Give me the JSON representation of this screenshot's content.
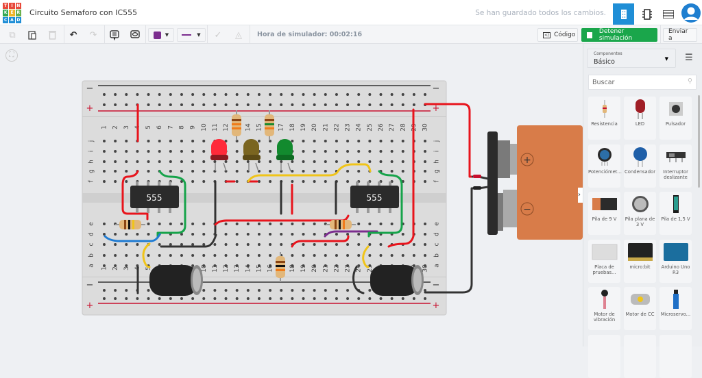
{
  "app": {
    "logo_letters": [
      "T",
      "I",
      "N",
      "K",
      "E",
      "R",
      "C",
      "A",
      "D"
    ],
    "title": "Circuito Semaforo con IC555",
    "save_status": "Se han guardado todos los cambios."
  },
  "header_icons": [
    "breadboard-view-icon",
    "schematic-view-icon",
    "component-list-icon",
    "user-avatar-icon"
  ],
  "toolbar": {
    "sim_time_label": "Hora de simulador: 00:02:16",
    "code_label": "Código",
    "stop_sim_label": "Detener simulación",
    "send_label": "Enviar a",
    "wire_color": "#7b2d8e"
  },
  "sidebar": {
    "components_label": "Componentes",
    "components_value": "Básico",
    "search_placeholder": "Buscar",
    "items": [
      {
        "label": "Resistencia",
        "icon": "resistor"
      },
      {
        "label": "LED",
        "icon": "led"
      },
      {
        "label": "Pulsador",
        "icon": "pushbutton"
      },
      {
        "label": "Potenciómet...",
        "icon": "potentiometer"
      },
      {
        "label": "Condensador",
        "icon": "capacitor"
      },
      {
        "label": "Interruptor deslizante",
        "icon": "slide-switch"
      },
      {
        "label": "Pila de 9 V",
        "icon": "battery-9v"
      },
      {
        "label": "Pila plana de 3 V",
        "icon": "coin-cell"
      },
      {
        "label": "Pila de 1,5 V",
        "icon": "battery-aa"
      },
      {
        "label": "Placa de pruebas...",
        "icon": "breadboard"
      },
      {
        "label": "micro:bit",
        "icon": "microbit"
      },
      {
        "label": "Arduino Uno R3",
        "icon": "arduino"
      },
      {
        "label": "Motor de vibración",
        "icon": "vibration-motor"
      },
      {
        "label": "Motor de CC",
        "icon": "dc-motor"
      },
      {
        "label": "Microservo...",
        "icon": "microservo"
      },
      {
        "label": "",
        "icon": "more"
      },
      {
        "label": "",
        "icon": "more"
      },
      {
        "label": "",
        "icon": "more"
      }
    ]
  },
  "breadboard": {
    "columns": [
      "1",
      "2",
      "3",
      "4",
      "5",
      "6",
      "7",
      "8",
      "9",
      "10",
      "11",
      "12",
      "13",
      "14",
      "15",
      "16",
      "17",
      "18",
      "19",
      "20",
      "21",
      "22",
      "23",
      "24",
      "25",
      "26",
      "27",
      "28",
      "29",
      "30"
    ],
    "rows_top": [
      "j",
      "i",
      "h",
      "g",
      "f"
    ],
    "rows_bottom": [
      "e",
      "d",
      "c",
      "b",
      "a"
    ],
    "rail_minus": "−",
    "rail_plus": "+",
    "chip_label": "555"
  },
  "battery": {
    "plus": "+",
    "minus": "−"
  }
}
